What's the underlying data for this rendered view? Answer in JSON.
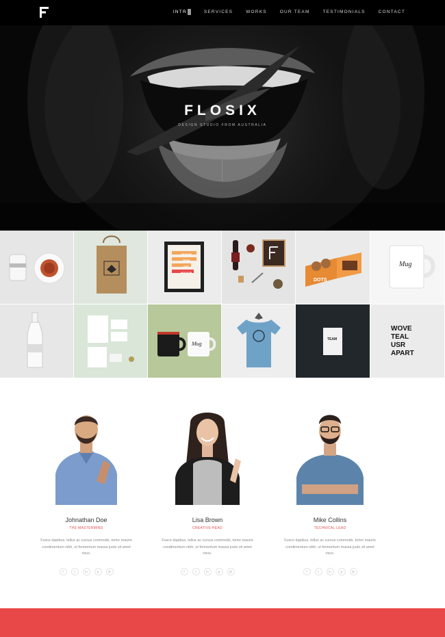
{
  "nav": {
    "logo": "F",
    "links": [
      {
        "label": "INTR",
        "active": true
      },
      {
        "label": "SERVICES",
        "active": false
      },
      {
        "label": "WORKS",
        "active": false
      },
      {
        "label": "OUR TEAM",
        "active": false
      },
      {
        "label": "TESTIMONIALS",
        "active": false
      },
      {
        "label": "CONTACT",
        "active": false
      }
    ]
  },
  "hero": {
    "title": "FLOSIX",
    "subtitle": "DESIGN STUDIO FROM AUSTRALIA"
  },
  "portfolio": {
    "tiles": [
      {
        "name": "tea-cup-mockup",
        "bg": "#e6e6e6"
      },
      {
        "name": "paper-bag-mockup",
        "bg": "#dfe7df"
      },
      {
        "name": "poster-frame-mockup",
        "bg": "#ececec"
      },
      {
        "name": "stationery-flatlay",
        "bg": "#e4e4e4"
      },
      {
        "name": "donut-box-mockup",
        "bg": "#eaeaea"
      },
      {
        "name": "mug-mockup",
        "bg": "#f6f6f6"
      },
      {
        "name": "bottle-mockup",
        "bg": "#e7e7e7"
      },
      {
        "name": "business-cards-mockup",
        "bg": "#d9e6d8"
      },
      {
        "name": "mugs-pair-mockup",
        "bg": "#b7c89a"
      },
      {
        "name": "tshirt-mockup",
        "bg": "#eeeeee"
      },
      {
        "name": "book-mockup",
        "bg": "#22272b"
      },
      {
        "name": "typography-poster",
        "bg": "#ebebeb"
      }
    ],
    "poster_text": {
      "frame_lines": [
        "ORANGE",
        "TEAM",
        "PSD",
        "MOCKUP"
      ],
      "dots": "DOTS",
      "mug": "Mug",
      "team": "TEAM",
      "typo": [
        "WOVE",
        "TEAL",
        "USR",
        "APART"
      ]
    }
  },
  "team": {
    "members": [
      {
        "name": "Johnathan Doe",
        "role": "THE MASTERMIND",
        "bio": "Fusce dapibus, tellus ac cursus commodo, tortor mauris condimentum nibh, ut fermentum massa justo sit amet risus."
      },
      {
        "name": "Lisa Brown",
        "role": "CREATIVE HEAD",
        "bio": "Fusce dapibus, tellus ac cursus commodo, tortor mauris condimentum nibh, ut fermentum massa justo sit amet risus."
      },
      {
        "name": "Mike Collins",
        "role": "TECHNICAL LEAD",
        "bio": "Fusce dapibus, tellus ac cursus commodo, tortor mauris condimentum nibh, ut fermentum massa justo sit amet risus."
      }
    ],
    "social_icons": [
      "f",
      "t",
      "in",
      "p",
      "dr"
    ],
    "social_icon_names": [
      "facebook-icon",
      "twitter-icon",
      "linkedin-icon",
      "pinterest-icon",
      "dribbble-icon"
    ]
  },
  "colors": {
    "accent": "#e84848",
    "nav_bg": "#000000"
  }
}
